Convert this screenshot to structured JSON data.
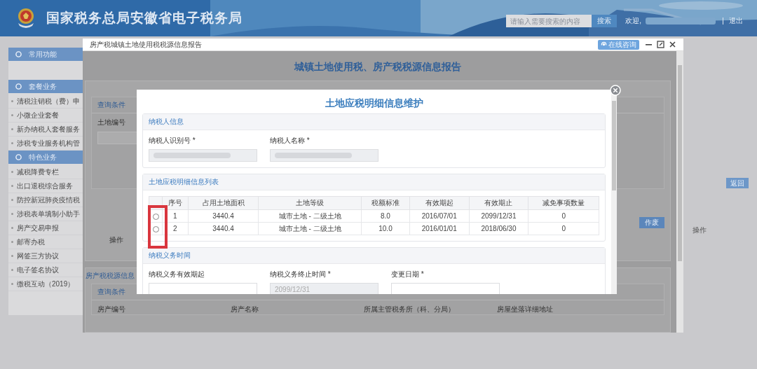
{
  "header": {
    "title": "国家税务总局安徽省电子税务局",
    "search": {
      "placeholder": "请输入需要搜索的内容"
    },
    "search_button": "搜索",
    "welcome": "欢迎,",
    "logout": "退出"
  },
  "sidebar": {
    "sections": [
      {
        "label": "常用功能"
      },
      {
        "label": "套餐业务",
        "items": [
          "清税注销税（费）申",
          "小微企业套餐",
          "新办纳税人套餐服务",
          "涉税专业服务机构管"
        ]
      },
      {
        "label": "特色业务",
        "items": [
          "减税降费专栏",
          "出口退税综合服务",
          "防控新冠肺炎疫情税",
          "涉税表单填制小助手",
          "房产交易申报",
          "邮寄办税",
          "网签三方协议",
          "电子签名协议",
          "缴税互动（2019）"
        ]
      }
    ]
  },
  "page": {
    "return_button": "返回",
    "column": "操作"
  },
  "window": {
    "title": "房产税城镇土地使用税税源信息报告",
    "consult_button": "在线咨询",
    "heading": "城镇土地使用税、房产税税源信息报告",
    "land_panel": {
      "query_label": "查询条件",
      "field_label": "土地编号",
      "void_button": "作废",
      "column": "操作"
    },
    "house_panel": {
      "title": "房产税税源信息",
      "query_label": "查询条件",
      "fields": [
        "房产编号",
        "房产名称",
        "所属主管税务所（科、分局）",
        "房屋坐落详细地址"
      ]
    }
  },
  "dialog": {
    "title": "土地应税明细信息维护",
    "taxpayer": {
      "title": "纳税人信息",
      "fields": [
        {
          "label": "纳税人识别号 *",
          "disabled": true
        },
        {
          "label": "纳税人名称 *",
          "disabled": true
        }
      ]
    },
    "list": {
      "title": "土地应税明细信息列表",
      "columns": [
        "序号",
        "占用土地面积",
        "土地等级",
        "税额标准",
        "有效期起",
        "有效期止",
        "减免事项数量"
      ],
      "rows": [
        {
          "selected": false,
          "cells": [
            "1",
            "3440.4",
            "城市土地 - 二级土地",
            "8.0",
            "2016/07/01",
            "2099/12/31",
            "0"
          ]
        },
        {
          "selected": false,
          "cells": [
            "2",
            "3440.4",
            "城市土地 - 二级土地",
            "10.0",
            "2016/01/01",
            "2018/06/30",
            "0"
          ]
        }
      ]
    },
    "duty": {
      "title": "纳税义务时间",
      "fields": [
        {
          "label": "纳税义务有效期起",
          "disabled": false
        },
        {
          "label": "纳税义务终止时间 *",
          "disabled": true,
          "value": "2099/12/31"
        },
        {
          "label": "变更日期 *",
          "disabled": false
        }
      ]
    }
  }
}
